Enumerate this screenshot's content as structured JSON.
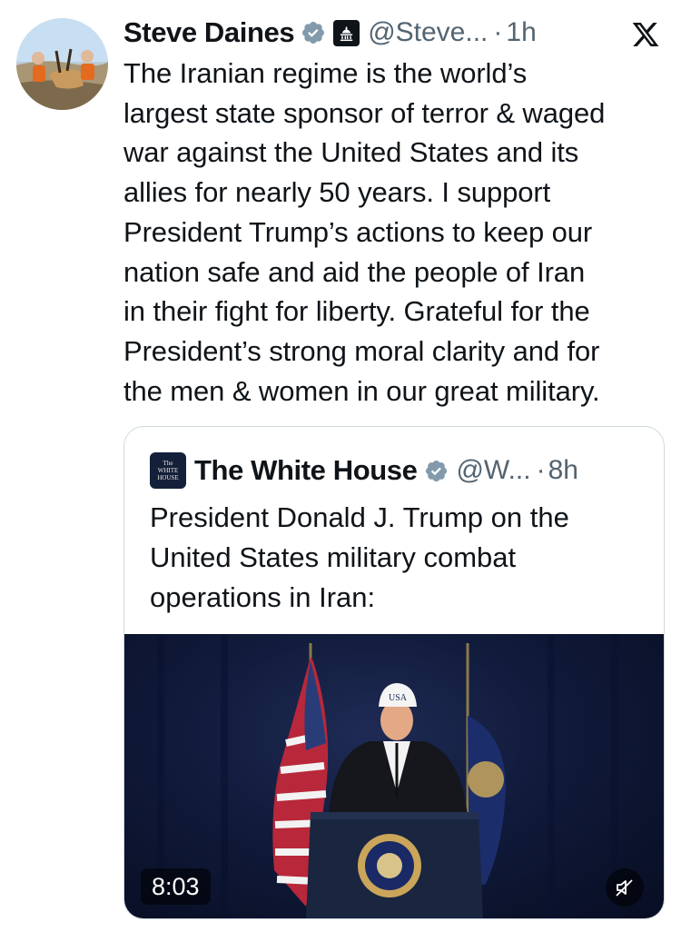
{
  "tweet": {
    "author": {
      "name": "Steve Daines",
      "handle": "@Steve...",
      "separator": "·",
      "time": "1h"
    },
    "text_lines": [
      "The Iranian regime is the world’s",
      "largest state sponsor of terror & waged",
      "war against the United States and its",
      "allies for nearly 50 years. I support",
      "President Trump’s actions to keep our",
      "nation safe and aid the people of Iran",
      "in their fight for liberty. Grateful for the",
      "President’s strong moral clarity and for",
      "the men & women in our great military."
    ],
    "icons": {
      "verified": "verified-badge-icon",
      "affiliation": "capitol-building-icon",
      "close": "x-logo-icon"
    }
  },
  "quote": {
    "author": {
      "avatar_text": [
        "The",
        "WHITE",
        "HOUSE"
      ],
      "name": "The White House",
      "handle": "@W...",
      "separator": "·",
      "time": "8h"
    },
    "text_lines": [
      "President Donald J. Trump on the",
      "United States military combat",
      "operations in Iran:"
    ],
    "video": {
      "duration": "8:03",
      "mute_icon": "speaker-muted-icon",
      "cap_text": "USA"
    }
  },
  "colors": {
    "text_primary": "#0f1419",
    "text_secondary": "#536471",
    "verified_blue": "#1d9bf0",
    "verified_gray": "#829aab",
    "border": "#cfd9de"
  }
}
